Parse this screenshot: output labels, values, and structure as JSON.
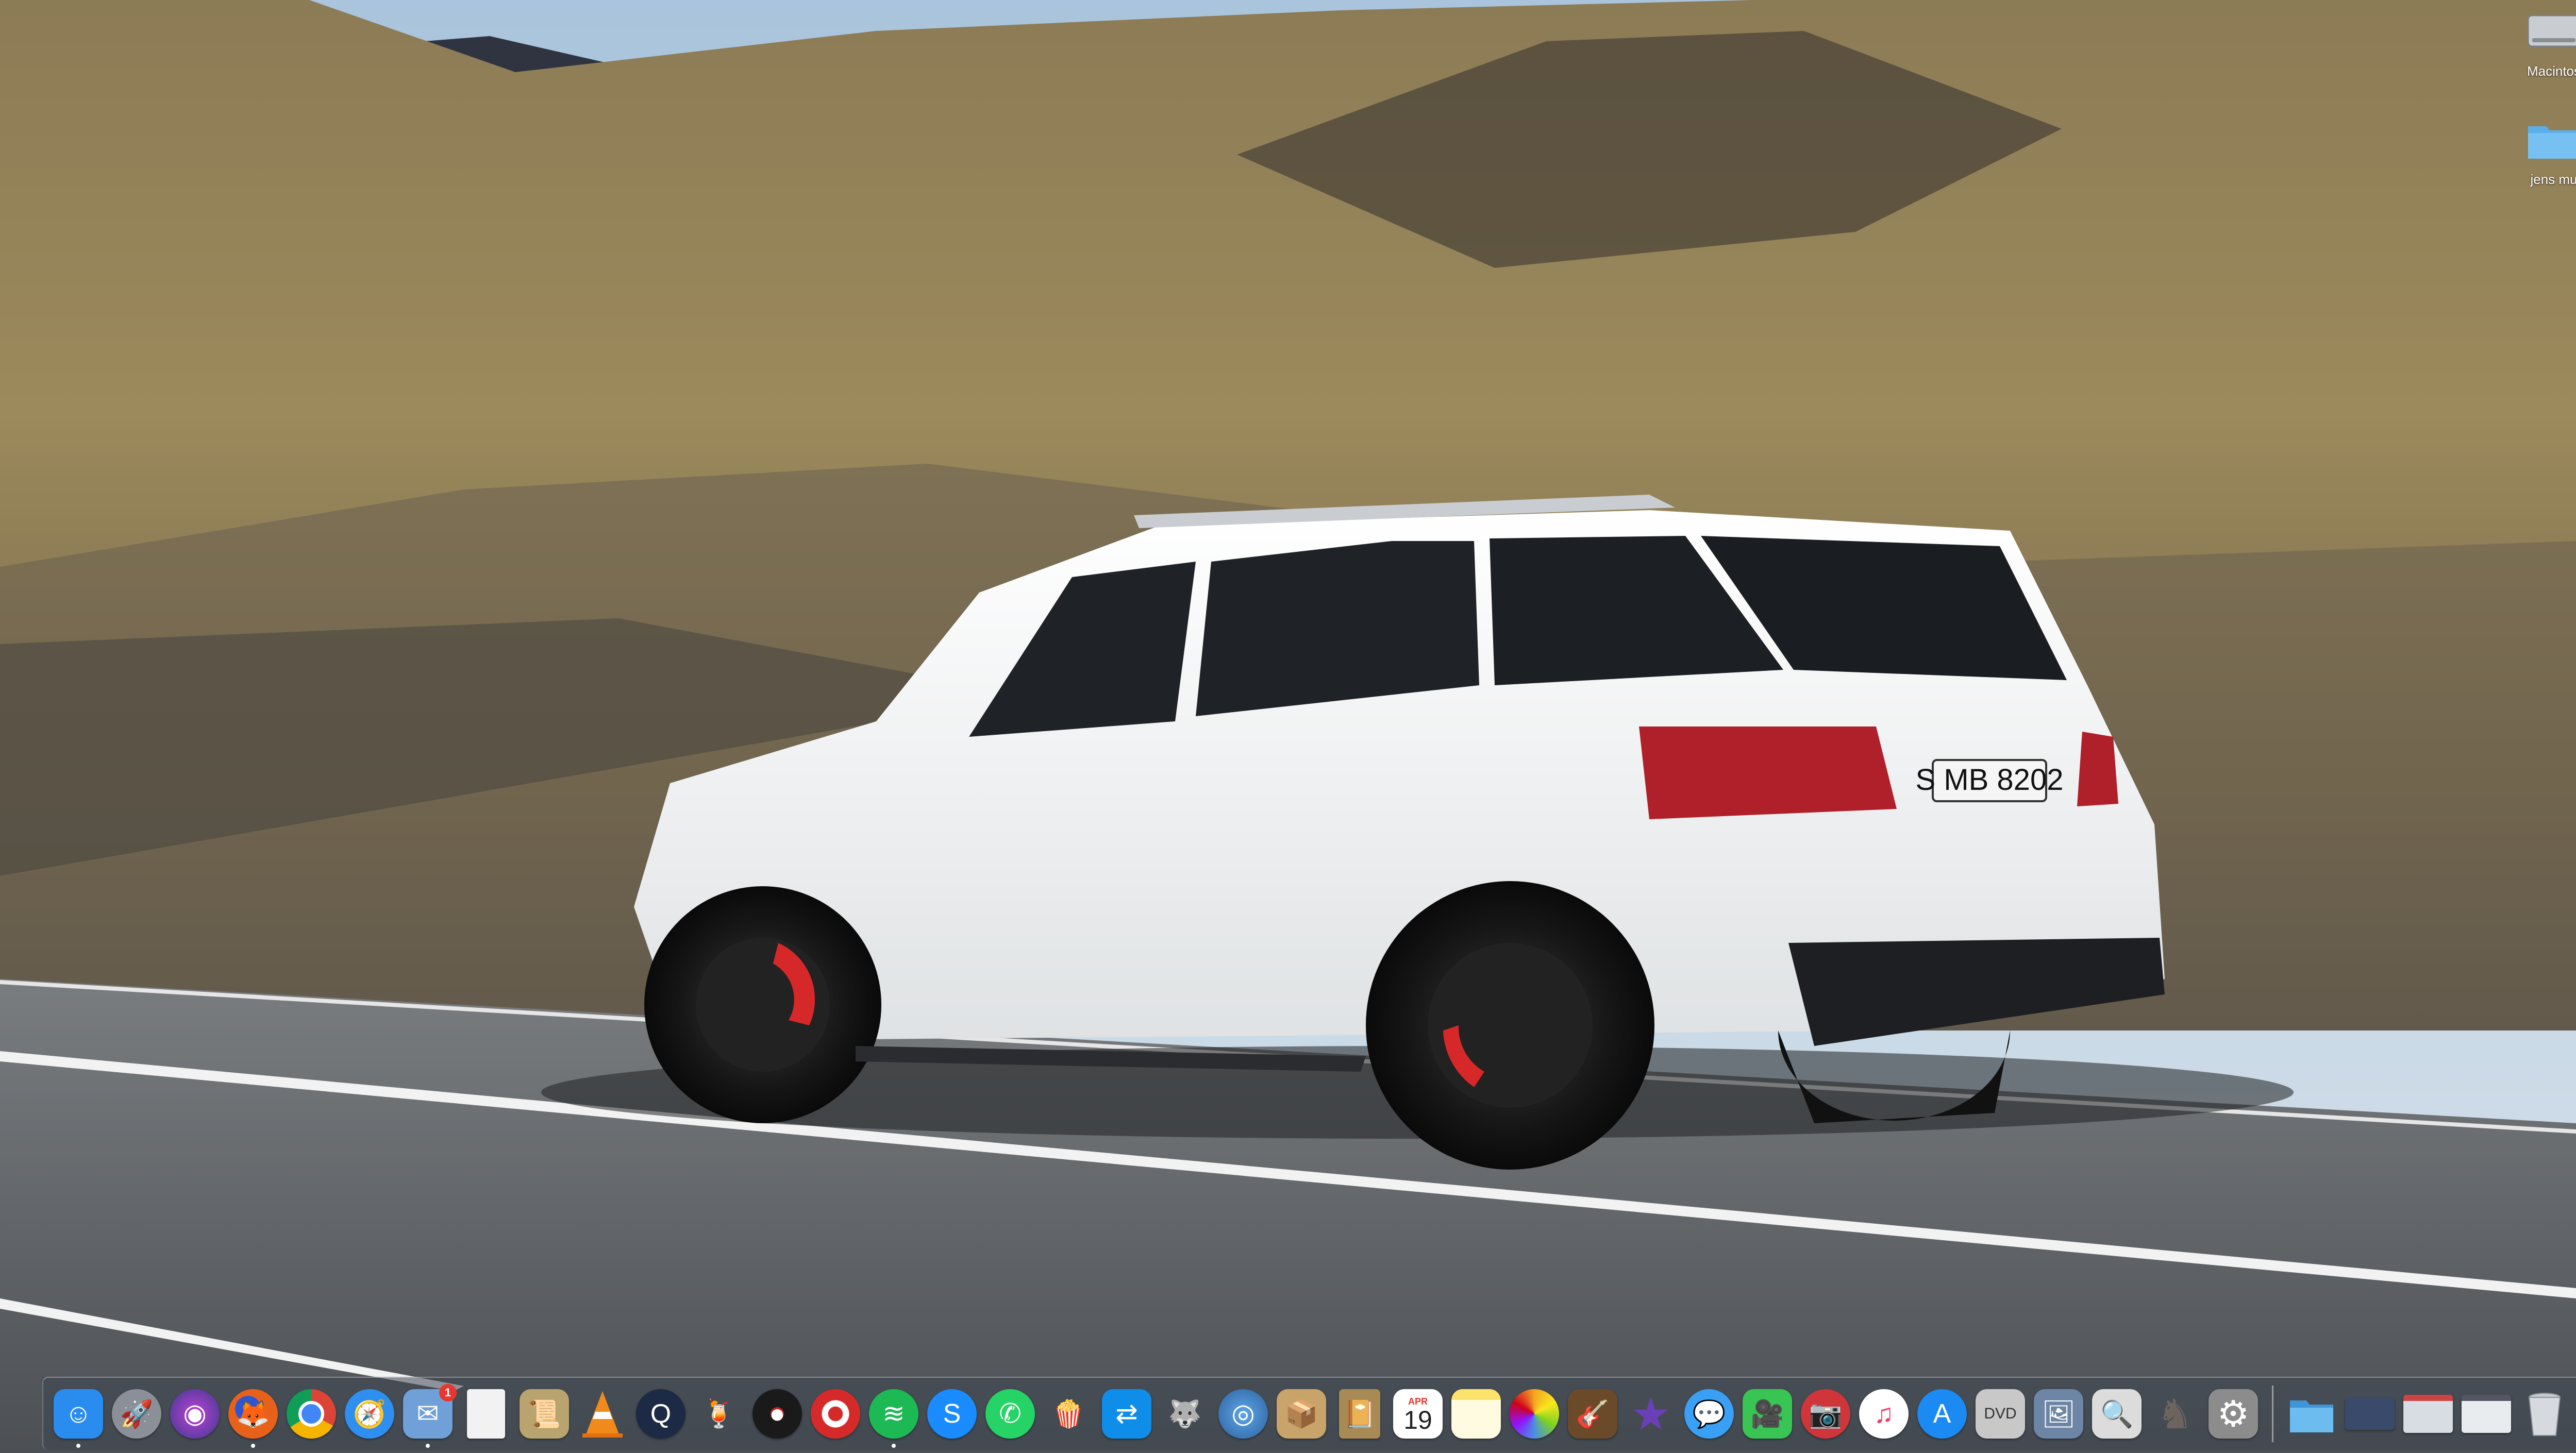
{
  "desktop": {
    "icons": [
      {
        "name": "Macintos",
        "icon": "hard-drive-icon"
      },
      {
        "name": "jens mu",
        "icon": "folder-icon"
      }
    ]
  },
  "dock": {
    "apps": [
      {
        "id": "finder",
        "icon": "finder-icon",
        "color": "#2b8cf0",
        "running": true
      },
      {
        "id": "launchpad",
        "icon": "rocket-icon",
        "color": "#8a8f98",
        "running": false
      },
      {
        "id": "siri",
        "icon": "siri-icon",
        "color": "#3a3a8c",
        "running": false
      },
      {
        "id": "firefox",
        "icon": "firefox-icon",
        "color": "#e8611a",
        "running": true
      },
      {
        "id": "chrome",
        "icon": "chrome-icon",
        "color": "#e9e9e9",
        "running": false
      },
      {
        "id": "safari",
        "icon": "compass-icon",
        "color": "#2f8ff0",
        "running": false
      },
      {
        "id": "mail-stamp",
        "icon": "stamp-icon",
        "color": "#6fa0d8",
        "running": true,
        "badge": "1"
      },
      {
        "id": "document",
        "icon": "blank-document-icon",
        "color": "#f2f2f2",
        "running": false
      },
      {
        "id": "script-editor",
        "icon": "script-icon",
        "color": "#b9a36e",
        "running": false
      },
      {
        "id": "vlc",
        "icon": "traffic-cone-icon",
        "color": "#f08a1a",
        "running": false
      },
      {
        "id": "quicktime",
        "icon": "quicktime-icon",
        "color": "#1d2a45",
        "running": false
      },
      {
        "id": "cocktail",
        "icon": "cocktail-icon",
        "color": "#5a8a3a",
        "running": false
      },
      {
        "id": "vinyl",
        "icon": "vinyl-record-icon",
        "color": "#1a1a1a",
        "running": false
      },
      {
        "id": "target-app",
        "icon": "target-icon",
        "color": "#d62a2a",
        "running": false
      },
      {
        "id": "spotify",
        "icon": "spotify-icon",
        "color": "#1db954",
        "running": true
      },
      {
        "id": "shazam",
        "icon": "shazam-icon",
        "color": "#1a8cff",
        "running": false
      },
      {
        "id": "whatsapp",
        "icon": "whatsapp-icon",
        "color": "#25d366",
        "running": false
      },
      {
        "id": "popcorn",
        "icon": "popcorn-icon",
        "color": "#f4f4f4",
        "running": false
      },
      {
        "id": "teamviewer",
        "icon": "teamviewer-icon",
        "color": "#0e8ee9",
        "running": false
      },
      {
        "id": "gimp",
        "icon": "gimp-icon",
        "color": "#7d6a50",
        "running": false
      },
      {
        "id": "network-radar",
        "icon": "radar-icon",
        "color": "#2c5f9e",
        "running": false
      },
      {
        "id": "archive",
        "icon": "box-icon",
        "color": "#c9a46a",
        "running": false
      },
      {
        "id": "notebook",
        "icon": "notebook-icon",
        "color": "#a88a55",
        "running": false
      },
      {
        "id": "calendar",
        "icon": "calendar-icon",
        "color": "#ffffff",
        "running": false,
        "month": "APR",
        "day": "19"
      },
      {
        "id": "notes",
        "icon": "notes-icon",
        "color": "#fbe36b",
        "running": false
      },
      {
        "id": "photos",
        "icon": "photos-icon",
        "color": "#ffffff",
        "running": false
      },
      {
        "id": "garageband",
        "icon": "guitar-icon",
        "color": "#c98a3a",
        "running": false
      },
      {
        "id": "imovie",
        "icon": "star-icon",
        "color": "#6a3fb8",
        "running": false
      },
      {
        "id": "messages",
        "icon": "messages-icon",
        "color": "#3aa0f5",
        "running": false
      },
      {
        "id": "facetime",
        "icon": "facetime-icon",
        "color": "#38c553",
        "running": false
      },
      {
        "id": "photo-booth",
        "icon": "photo-booth-icon",
        "color": "#d0353a",
        "running": false
      },
      {
        "id": "itunes",
        "icon": "music-note-icon",
        "color": "#f2406a",
        "running": false
      },
      {
        "id": "app-store",
        "icon": "app-store-icon",
        "color": "#1b8af2",
        "running": false
      },
      {
        "id": "dvd-player",
        "icon": "dvd-icon",
        "color": "#c8c8c8",
        "running": false
      },
      {
        "id": "image-capture",
        "icon": "scanner-icon",
        "color": "#6e86a6",
        "running": false
      },
      {
        "id": "preview",
        "icon": "preview-icon",
        "color": "#dcdcdc",
        "running": false
      },
      {
        "id": "chess",
        "icon": "chess-icon",
        "color": "#8f8a85",
        "running": false
      },
      {
        "id": "system-preferences",
        "icon": "gear-icon",
        "color": "#8c8c8c",
        "running": false
      }
    ],
    "stacks": [
      {
        "id": "folder",
        "icon": "folder-icon",
        "color": "#5aaeea"
      },
      {
        "id": "screenshot-1",
        "icon": "screenshot-icon",
        "color": "#3a4a6a"
      },
      {
        "id": "screenshot-2",
        "icon": "screenshot-icon",
        "color": "#d8dde4"
      },
      {
        "id": "screenshot-3",
        "icon": "screenshot-icon",
        "color": "#e9ecef"
      },
      {
        "id": "trash",
        "icon": "trash-icon",
        "color": "#d6dadf"
      }
    ]
  },
  "wallpaper": {
    "plate": "S MB 8202"
  }
}
